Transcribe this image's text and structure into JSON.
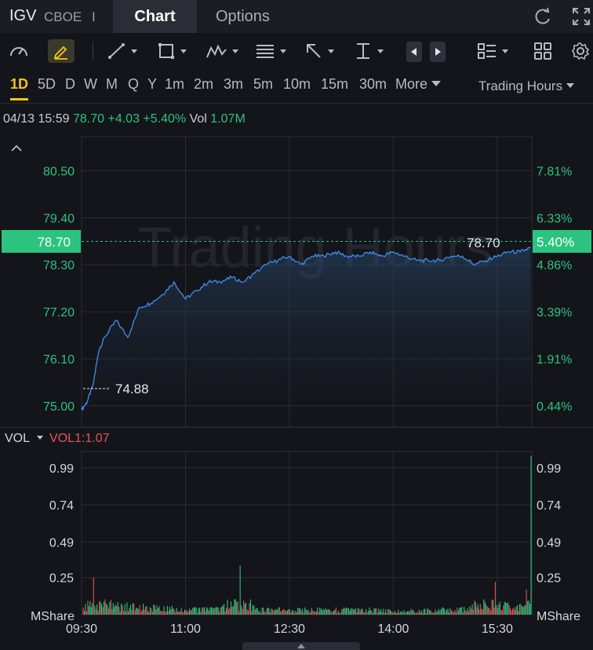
{
  "header": {
    "ticker": "IGV",
    "exchange": "CBOE",
    "separator": "I",
    "tabs": [
      "Chart",
      "Options"
    ]
  },
  "toolbar": {
    "icons": [
      "gauge-icon",
      "draw-pencil-icon",
      "line-tool-icon",
      "rectangle-tool-icon",
      "pattern-tool-icon",
      "fib-tool-icon",
      "arrow-tool-icon",
      "measure-tool-icon",
      "prev-icon",
      "next-icon",
      "layout-list-icon",
      "grid-icon",
      "settings-icon"
    ]
  },
  "periods": {
    "items": [
      "1D",
      "5D",
      "D",
      "W",
      "M",
      "Q",
      "Y",
      "1m",
      "2m",
      "3m",
      "5m",
      "10m",
      "15m",
      "30m"
    ],
    "active": "1D",
    "more_label": "More",
    "session_label": "Trading Hours"
  },
  "quote": {
    "datetime": "04/13 15:59",
    "price": "78.70",
    "change": "+4.03",
    "change_pct": "+5.40%",
    "vol_label": "Vol",
    "vol_value": "1.07M"
  },
  "chart": {
    "watermark": "Trading Hours",
    "current_price_label": "78.70",
    "current_pct_label": "5.40%",
    "low_label": "74.88",
    "high_label": "78.70",
    "left_ticks": [
      "80.50",
      "79.40",
      "78.30",
      "77.20",
      "76.10",
      "75.00"
    ],
    "right_ticks": [
      "7.81%",
      "6.33%",
      "4.86%",
      "3.39%",
      "1.91%",
      "0.44%"
    ],
    "colors": {
      "up": "#2bc37e",
      "down": "#e2545a",
      "line": "#3d8df0",
      "grid": "#2a2d34"
    }
  },
  "volume": {
    "label": "VOL",
    "indicator": "VOL1:1.07",
    "left_ticks": [
      "0.99",
      "0.74",
      "0.49",
      "0.25"
    ],
    "right_ticks": [
      "0.99",
      "0.74",
      "0.49",
      "0.25"
    ],
    "unit": "MShare"
  },
  "time_axis": [
    "09:30",
    "11:00",
    "12:30",
    "14:00",
    "15:30"
  ],
  "chart_data": {
    "type": "line",
    "title": "",
    "xlabel": "",
    "ylabel": "",
    "x_range": [
      "09:30",
      "16:00"
    ],
    "ylim": [
      74.5,
      81.3
    ],
    "grid": true,
    "series": [
      {
        "x": [
          "09:30",
          "09:35",
          "09:40",
          "09:45",
          "09:50",
          "10:00",
          "10:10",
          "10:20",
          "10:30",
          "10:40",
          "10:50",
          "11:00",
          "11:10",
          "11:20",
          "11:30",
          "11:40",
          "11:50",
          "12:00",
          "12:10",
          "12:20",
          "12:30",
          "12:40",
          "12:50",
          "13:00",
          "13:10",
          "13:20",
          "13:30",
          "13:40",
          "13:50",
          "14:00",
          "14:10",
          "14:20",
          "14:30",
          "14:40",
          "14:50",
          "15:00",
          "15:10",
          "15:20",
          "15:30",
          "15:40",
          "15:50",
          "15:59"
        ],
        "y": [
          74.9,
          75.1,
          75.5,
          76.3,
          76.6,
          77.0,
          76.6,
          77.3,
          77.4,
          77.6,
          77.9,
          77.5,
          77.7,
          77.9,
          77.9,
          78.0,
          77.9,
          78.1,
          78.3,
          78.4,
          78.5,
          78.3,
          78.5,
          78.5,
          78.6,
          78.5,
          78.5,
          78.6,
          78.5,
          78.6,
          78.5,
          78.4,
          78.4,
          78.4,
          78.5,
          78.5,
          78.3,
          78.4,
          78.5,
          78.6,
          78.6,
          78.7
        ]
      }
    ],
    "volume_series": {
      "name": "VOL",
      "unit": "MShare",
      "ylim": [
        0,
        1.1
      ],
      "x": [
        "09:32",
        "09:40",
        "10:00",
        "10:30",
        "11:00",
        "11:30",
        "11:47",
        "12:00",
        "12:30",
        "13:00",
        "13:30",
        "14:00",
        "14:30",
        "15:00",
        "15:28",
        "15:45",
        "15:55",
        "15:59"
      ],
      "values": [
        0.05,
        0.25,
        0.08,
        0.06,
        0.05,
        0.05,
        0.33,
        0.04,
        0.05,
        0.04,
        0.05,
        0.03,
        0.04,
        0.05,
        0.22,
        0.08,
        0.17,
        1.07
      ]
    }
  }
}
